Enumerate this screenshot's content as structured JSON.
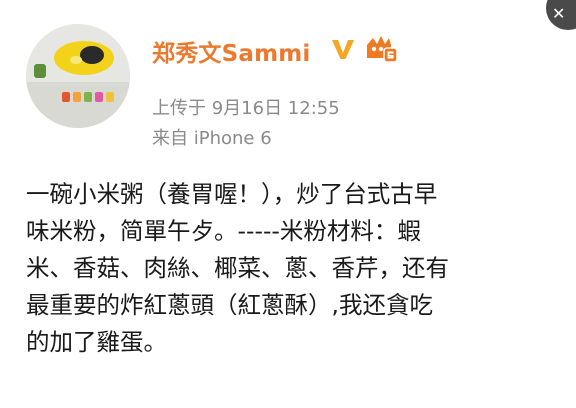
{
  "post": {
    "username": "郑秀文Sammi",
    "time_prefix": "上传于",
    "time": "9月16日 12:55",
    "source": "来自 iPhone 6",
    "content_lines": [
      "一碗小米粥（養胃喔！），炒了台式古早",
      "味米粉，简單午歺。-----米粉材料：蝦",
      "米、香菇、肉絲、椰菜、蔥、香芹，还有",
      "最重要的炸紅蔥頭（紅蔥酥）,我还貪吃",
      "的加了雞蛋。"
    ]
  },
  "colors": {
    "username": "#ec7a2e",
    "verified_badge": "#f5a623",
    "vip_badge": "#f07a22",
    "meta_text": "#8a8a8a",
    "body_text": "#1a1a1a"
  },
  "icons": {
    "verified": "verified-v-icon",
    "vip": "vip-crown-badge-icon",
    "close": "close-icon"
  }
}
